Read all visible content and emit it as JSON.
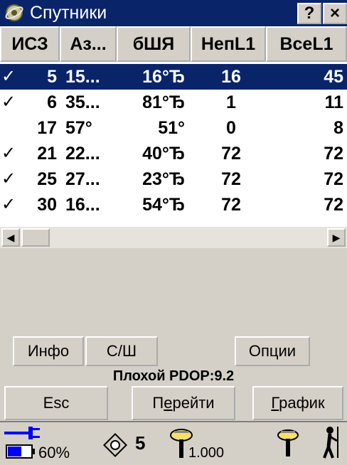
{
  "window": {
    "title": "Спутники",
    "help_label": "?",
    "close_label": "×"
  },
  "table": {
    "columns": [
      "ИСЗ",
      "Аз...",
      "бШЯ",
      "НепL1",
      "ВсеL1"
    ],
    "rows": [
      {
        "checked": true,
        "selected": true,
        "cells": [
          "5",
          "15...",
          "16°Ђ",
          "16",
          "45"
        ]
      },
      {
        "checked": true,
        "selected": false,
        "cells": [
          "6",
          "35...",
          "81°Ђ",
          "1",
          "11"
        ]
      },
      {
        "checked": false,
        "selected": false,
        "cells": [
          "17",
          "57°",
          "51°",
          "0",
          "8"
        ]
      },
      {
        "checked": true,
        "selected": false,
        "cells": [
          "21",
          "22...",
          "40°Ђ",
          "72",
          "72"
        ]
      },
      {
        "checked": true,
        "selected": false,
        "cells": [
          "25",
          "27...",
          "23°Ђ",
          "72",
          "72"
        ]
      },
      {
        "checked": true,
        "selected": false,
        "cells": [
          "30",
          "16...",
          "54°Ђ",
          "72",
          "72"
        ]
      }
    ],
    "check_mark": "✓"
  },
  "buttons": {
    "info": "Инфо",
    "snr": "С/Ш",
    "options": "Опции",
    "esc": "Esc",
    "goto_prefix": "П",
    "goto_underlined": "е",
    "goto_suffix": "рейти",
    "graph_underlined": "Г",
    "graph_suffix": "рафик"
  },
  "pdop_text": "Плохой PDOP:9.2",
  "status": {
    "battery_level": "60%",
    "battery_fraction": 0.6,
    "satellite_count": "5",
    "antenna_height": "1.000"
  },
  "colors": {
    "titlebar": "#0a246a",
    "selection": "#0a246a",
    "face": "#d4d0c8"
  },
  "icons": [
    "satellite-app-icon",
    "help-icon",
    "close-icon",
    "scroll-left-icon",
    "scroll-right-icon",
    "power-plug-icon",
    "battery-icon",
    "satellite-icon",
    "receiver-icon",
    "rover-icon",
    "surveyor-icon"
  ]
}
